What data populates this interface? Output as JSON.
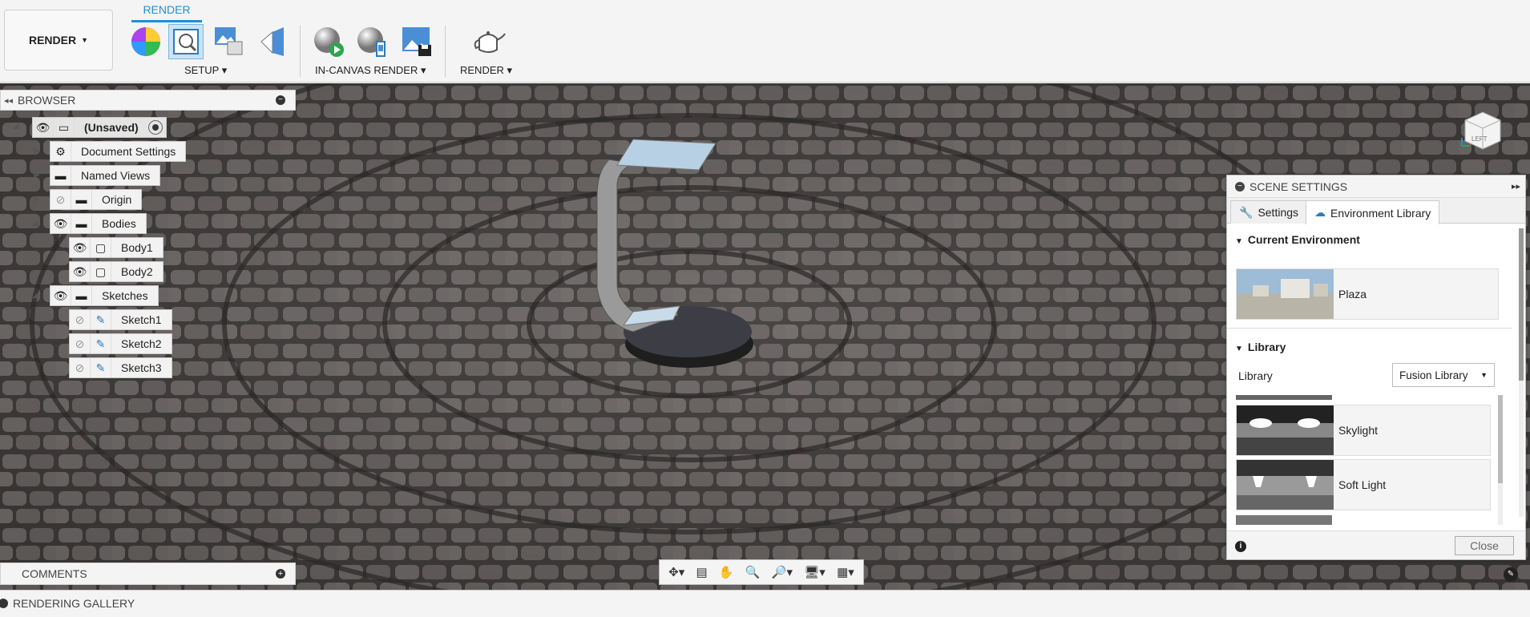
{
  "toolbar": {
    "workspace_label": "RENDER",
    "active_tab": "RENDER",
    "setup_label": "SETUP ▾",
    "incanvas_label": "IN-CANVAS RENDER ▾",
    "render_label": "RENDER ▾"
  },
  "browser": {
    "title": "BROWSER",
    "nodes": [
      {
        "label": "(Unsaved)"
      },
      {
        "label": "Document Settings"
      },
      {
        "label": "Named Views"
      },
      {
        "label": "Origin"
      },
      {
        "label": "Bodies"
      },
      {
        "label": "Body1"
      },
      {
        "label": "Body2"
      },
      {
        "label": "Sketches"
      },
      {
        "label": "Sketch1"
      },
      {
        "label": "Sketch2"
      },
      {
        "label": "Sketch3"
      }
    ]
  },
  "comments": {
    "title": "COMMENTS"
  },
  "gallery": {
    "title": "RENDERING GALLERY"
  },
  "viewcube": {
    "face": "LEFT"
  },
  "scene": {
    "title": "SCENE SETTINGS",
    "tabs": [
      {
        "label": "Settings"
      },
      {
        "label": "Environment Library"
      }
    ],
    "current_env_heading": "Current Environment",
    "current_env": "Plaza",
    "library_heading": "Library",
    "library_label": "Library",
    "library_select": "Fusion Library",
    "items": [
      {
        "name": "Skylight"
      },
      {
        "name": "Soft Light"
      }
    ],
    "close_label": "Close"
  },
  "colors": {
    "accent": "#1e8fd8"
  }
}
